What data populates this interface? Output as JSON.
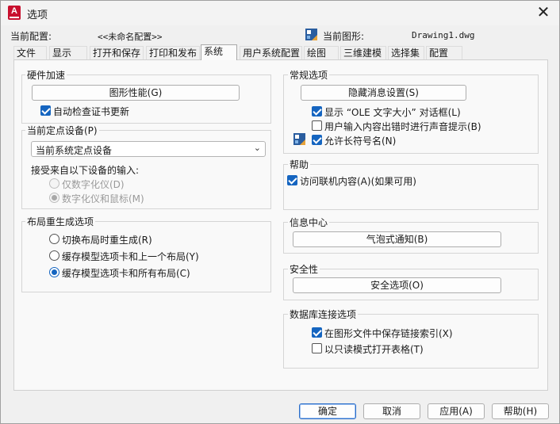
{
  "window": {
    "title": "选项",
    "app_icon_letter": "A",
    "close_glyph": "✕"
  },
  "profile": {
    "current_profile_label": "当前配置:",
    "current_profile_value": "<<未命名配置>>",
    "current_drawing_label": "当前图形:",
    "current_drawing_value": "Drawing1.dwg"
  },
  "tabs": [
    {
      "label": "文件"
    },
    {
      "label": "显示"
    },
    {
      "label": "打开和保存"
    },
    {
      "label": "打印和发布"
    },
    {
      "label": "系统",
      "active": true
    },
    {
      "label": "用户系统配置"
    },
    {
      "label": "绘图"
    },
    {
      "label": "三维建模"
    },
    {
      "label": "选择集"
    },
    {
      "label": "配置"
    }
  ],
  "hardware": {
    "title": "硬件加速",
    "graphics_button": "图形性能(G)",
    "auto_check_cert": "自动检查证书更新",
    "auto_check_cert_checked": true
  },
  "pointing": {
    "title": "当前定点设备(P)",
    "device_select": "当前系统定点设备",
    "accept_input_label": "接受来自以下设备的输入:",
    "digitizer_only": "仅数字化仪(D)",
    "digitizer_and_mouse": "数字化仪和鼠标(M)",
    "selected": "digitizer_and_mouse"
  },
  "layout_regen": {
    "title": "布局重生成选项",
    "options": [
      {
        "label": "切换布局时重生成(R)",
        "checked": false
      },
      {
        "label": "缓存模型选项卡和上一个布局(Y)",
        "checked": false
      },
      {
        "label": "缓存模型选项卡和所有布局(C)",
        "checked": true
      }
    ]
  },
  "general": {
    "title": "常规选项",
    "hidden_msg_button": "隐藏消息设置(S)",
    "show_ole_size": "显示 “OLE 文字大小” 对话框(L)",
    "show_ole_size_checked": true,
    "beep_on_error": "用户输入内容出错时进行声音提示(B)",
    "beep_on_error_checked": false,
    "allow_long_symbol": "允许长符号名(N)",
    "allow_long_symbol_checked": true
  },
  "help": {
    "title": "帮助",
    "online_content": "访问联机内容(A)(如果可用)",
    "online_content_checked": true
  },
  "info_center": {
    "title": "信息中心",
    "balloon_button": "气泡式通知(B)"
  },
  "security": {
    "title": "安全性",
    "security_button": "安全选项(O)"
  },
  "db_connect": {
    "title": "数据库连接选项",
    "store_links": "在图形文件中保存链接索引(X)",
    "store_links_checked": true,
    "readonly_tables": "以只读模式打开表格(T)",
    "readonly_tables_checked": false
  },
  "footer": {
    "ok": "确定",
    "cancel": "取消",
    "apply": "应用(A)",
    "help": "帮助(H)"
  },
  "colors": {
    "accent": "#1565c0",
    "app_icon": "#c8102e"
  }
}
